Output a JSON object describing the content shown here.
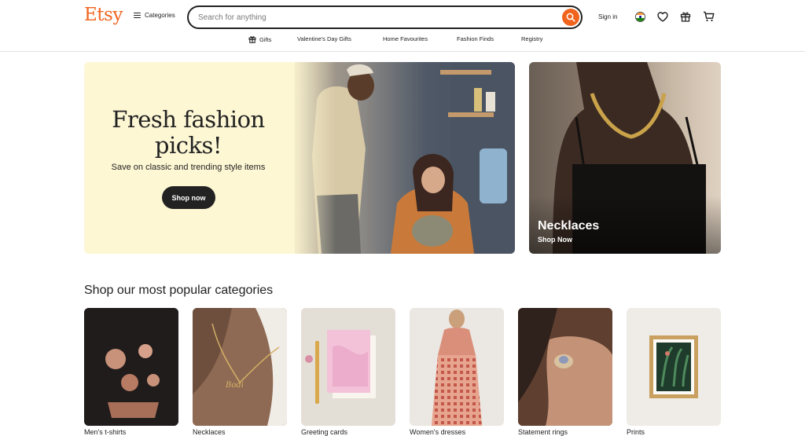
{
  "header": {
    "logo": "Etsy",
    "categories_label": "Categories",
    "search": {
      "placeholder": "Search for anything",
      "value": ""
    },
    "sign_in": "Sign in"
  },
  "subnav": {
    "items": [
      "Gifts",
      "Valentine's Day Gifts",
      "Home Favourites",
      "Fashion Finds",
      "Registry"
    ]
  },
  "hero": {
    "title_line1": "Fresh fashion",
    "title_line2": "picks!",
    "subtitle": "Save on classic and trending style items",
    "button": "Shop now"
  },
  "promo": {
    "title": "Necklaces",
    "subtitle": "Shop Now"
  },
  "popular": {
    "title": "Shop our most popular categories",
    "items": [
      "Men's t-shirts",
      "Necklaces",
      "Greeting cards",
      "Women's dresses",
      "Statement rings",
      "Prints"
    ]
  },
  "colors": {
    "brand": "#f1641e",
    "hero_bg": "#fdf7d4",
    "text": "#222222"
  },
  "icons": [
    "hamburger-icon",
    "search-icon",
    "flag-icon",
    "heart-icon",
    "gift-icon",
    "cart-icon"
  ]
}
